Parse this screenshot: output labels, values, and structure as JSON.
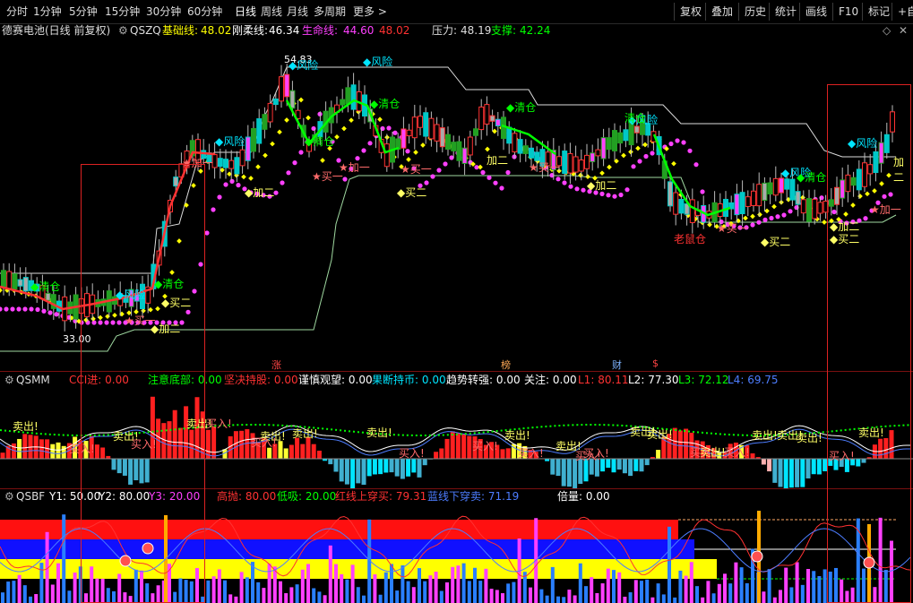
{
  "toolbar": {
    "periods": [
      "分时",
      "1分钟",
      "5分钟",
      "15分钟",
      "30分钟",
      "60分钟",
      "日线",
      "周线",
      "月线",
      "多周期",
      "更多 >"
    ],
    "selected": "日线",
    "right_buttons": [
      "复权",
      "叠加",
      "历史",
      "统计",
      "画线",
      "F10",
      "标记",
      "+自"
    ]
  },
  "main_header": {
    "title": "德赛电池(日线 前复权)",
    "indicator": "QSZQ",
    "base_label": "基础线:",
    "base_value": "48.02",
    "rigid_label": "刚柔线:",
    "rigid_value": "46.34",
    "life_label": "生命线:",
    "life_value": "44.60",
    "extra_value": "48.02",
    "pressure_label": "压力:",
    "pressure_value": "48.19",
    "support_label": "支撑:",
    "support_value": "42.24"
  },
  "main_annotations": {
    "high_price": "54.83",
    "low_price": "33.00",
    "risk": "风险",
    "clear": "清仓",
    "buy1": "买一",
    "buy2": "买二",
    "add1": "加一",
    "add2": "加二",
    "old_rat": "老鼠仓"
  },
  "event_markers": [
    "涨",
    "榜",
    "财",
    "$"
  ],
  "qsmm_header": {
    "name": "QSMM",
    "cci_label": "CCI进:",
    "cci_value": "0.00",
    "bottom_label": "注意底部:",
    "bottom_value": "0.00",
    "resolute_label": "坚决持股:",
    "resolute_value": "0.00",
    "cautious_label": "谨慎观望:",
    "cautious_value": "0.00",
    "decisive_label": "果断持币:",
    "decisive_value": "0.00",
    "trend_label": "趋势转强:",
    "trend_value": "0.00",
    "focus_label": "关注:",
    "focus_value": "0.00",
    "l1_label": "L1:",
    "l1_value": "80.11",
    "l2_label": "L2:",
    "l2_value": "77.30",
    "l3_label": "L3:",
    "l3_value": "72.12",
    "l4_label": "L4:",
    "l4_value": "69.75"
  },
  "qsmm_annotations": {
    "sell": "卖出!",
    "buy": "买入!"
  },
  "qsbf_header": {
    "name": "QSBF",
    "y1_label": "Y1:",
    "y1_value": "50.00",
    "y2_label": "Y2:",
    "y2_value": "80.00",
    "y3_label": "Y3:",
    "y3_value": "20.00",
    "high_label": "高抛:",
    "high_value": "80.00",
    "low_label": "低吸:",
    "low_value": "20.00",
    "red_label": "红线上穿买:",
    "red_value": "79.31",
    "blue_label": "蓝线下穿卖:",
    "blue_value": "71.19",
    "mult_label": "倍量:",
    "mult_value": "0.00"
  },
  "colors": {
    "up": "#ff3232",
    "down": "#00c8c8",
    "base": "#ffff00",
    "rigid": "#ff40ff",
    "green": "#00ff00",
    "white": "#ffffff",
    "panel_sep": "#7a1010"
  }
}
